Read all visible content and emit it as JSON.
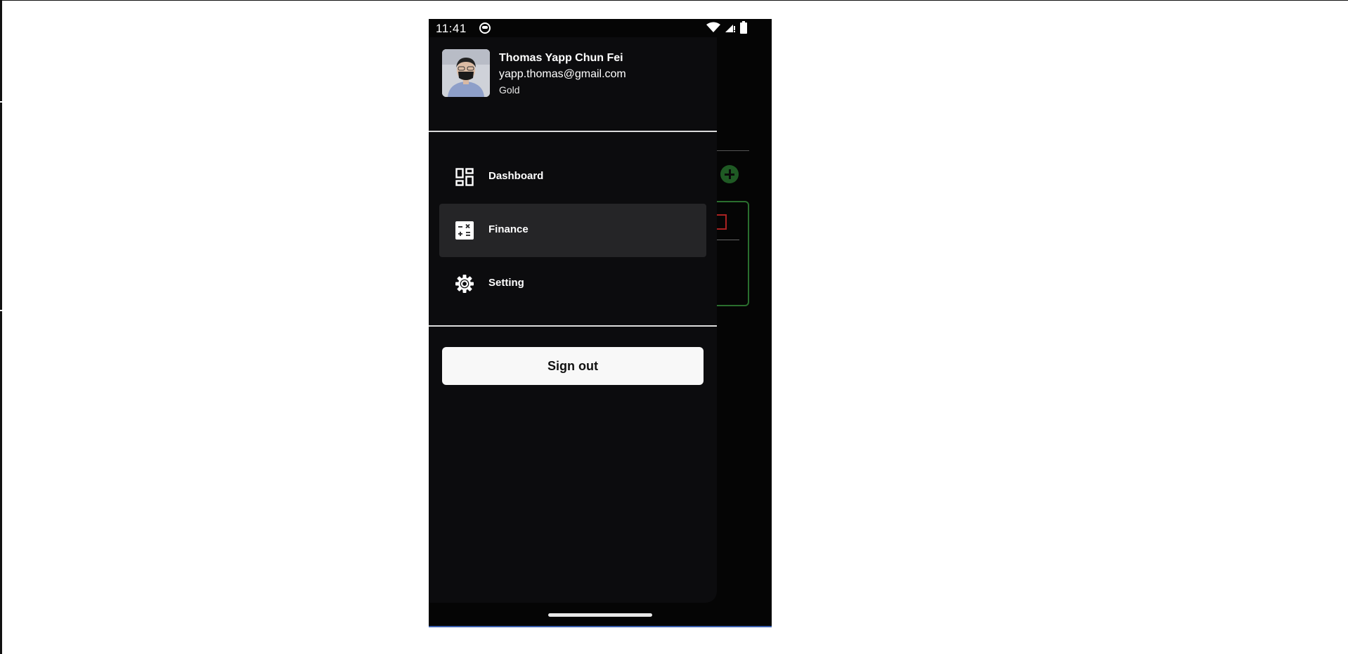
{
  "status_bar": {
    "time": "11:41",
    "icons": [
      "app-face-icon",
      "wifi-icon",
      "signal-icon",
      "battery-icon"
    ]
  },
  "profile": {
    "name": "Thomas Yapp Chun Fei",
    "email": "yapp.thomas@gmail.com",
    "tier": "Gold"
  },
  "nav": {
    "items": [
      {
        "label": "Dashboard",
        "icon": "dashboard-icon",
        "active": false
      },
      {
        "label": "Finance",
        "icon": "calculator-icon",
        "active": true
      },
      {
        "label": "Setting",
        "icon": "gear-icon",
        "active": false
      }
    ]
  },
  "actions": {
    "sign_out_label": "Sign out"
  },
  "colors": {
    "drawer_bg": "#0c0c0e",
    "active_item_bg": "#252527",
    "button_bg": "#f8f8f8",
    "accent_green": "#2a6e2e"
  }
}
